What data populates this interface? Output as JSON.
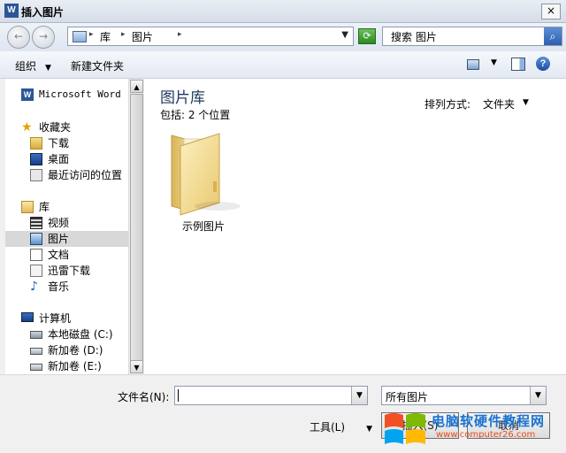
{
  "window": {
    "title": "插入图片",
    "app_icon": "W",
    "close_glyph": "×"
  },
  "nav": {
    "back_glyph": "←",
    "forward_glyph": "→",
    "breadcrumb": [
      "库",
      "图片"
    ],
    "search_placeholder": "搜索 图片"
  },
  "toolbar": {
    "organize": "组织",
    "new_folder": "新建文件夹",
    "help": "?"
  },
  "sidebar": {
    "items": [
      {
        "label": "Microsoft Word",
        "icon": "word-icon"
      },
      {
        "label": "收藏夹",
        "icon": "star-icon"
      },
      {
        "label": "下载",
        "icon": "download-folder-icon"
      },
      {
        "label": "桌面",
        "icon": "desktop-icon"
      },
      {
        "label": "最近访问的位置",
        "icon": "recent-places-icon"
      },
      {
        "label": "库",
        "icon": "library-icon"
      },
      {
        "label": "视频",
        "icon": "video-icon"
      },
      {
        "label": "图片",
        "icon": "pictures-icon",
        "selected": true
      },
      {
        "label": "文档",
        "icon": "documents-icon"
      },
      {
        "label": "迅雷下载",
        "icon": "thunder-download-icon"
      },
      {
        "label": "音乐",
        "icon": "music-icon"
      },
      {
        "label": "计算机",
        "icon": "computer-icon"
      },
      {
        "label": "本地磁盘 (C:)",
        "icon": "local-disk-icon"
      },
      {
        "label": "新加卷 (D:)",
        "icon": "drive-icon"
      },
      {
        "label": "新加卷 (E:)",
        "icon": "drive-icon"
      }
    ]
  },
  "content": {
    "title": "图片库",
    "subtitle": "包括: 2 个位置",
    "arrange_label": "排列方式:",
    "arrange_value": "文件夹",
    "items": [
      {
        "label": "示例图片",
        "icon": "folder-icon"
      }
    ]
  },
  "bottom": {
    "filename_label": "文件名(N):",
    "filename_value": "",
    "filter_value": "所有图片",
    "tools_label": "工具(L)",
    "open_label": "插入(S)",
    "cancel_label": "取消"
  },
  "watermark": {
    "title": "电脑软硬件教程网",
    "url": "www.computer26.com"
  }
}
